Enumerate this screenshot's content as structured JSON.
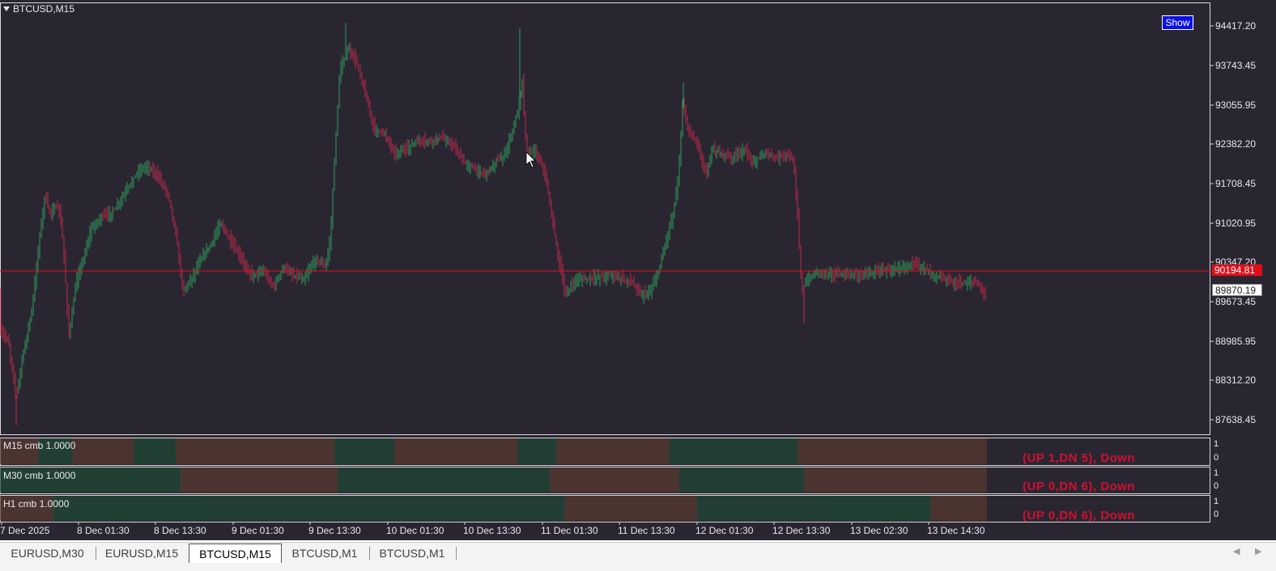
{
  "chart": {
    "symbol_title": "BTCUSD,M15",
    "show_button": "Show",
    "price_ticks": [
      "94417.20",
      "93743.45",
      "93055.95",
      "92382.20",
      "91708.45",
      "91020.95",
      "90347.20",
      "89673.45",
      "88985.95",
      "88312.20",
      "87638.45"
    ],
    "price_line_label": "90194.81",
    "bid_label": "89870.19",
    "time_ticks": [
      "7 Dec 2025",
      "8 Dec 01:30",
      "8 Dec 13:30",
      "9 Dec 01:30",
      "9 Dec 13:30",
      "10 Dec 01:30",
      "10 Dec 13:30",
      "11 Dec 01:30",
      "11 Dec 13:30",
      "12 Dec 01:30",
      "12 Dec 13:30",
      "13 Dec 02:30",
      "13 Dec 14:30"
    ],
    "colors": {
      "background": "#2a2631",
      "bull": "#2e9e5a",
      "bear": "#c0284a",
      "price_line": "#e0101a",
      "strip_up": "#1f4a36",
      "strip_down": "#5a3a30"
    }
  },
  "subwindows": [
    {
      "label": "M15 cmb  1.0000",
      "scale_top": "1",
      "scale_bottom": "0",
      "signal": "(UP 1,DN 5), Down"
    },
    {
      "label": "M30 cmb  1.0000",
      "scale_top": "1",
      "scale_bottom": "0",
      "signal": "(UP 0,DN 6), Down"
    },
    {
      "label": "H1 cmb  1.0000",
      "scale_top": "1",
      "scale_bottom": "0",
      "signal": "(UP 0,DN 6), Down"
    }
  ],
  "tabs": [
    {
      "label": "EURUSD,M30",
      "active": false
    },
    {
      "label": "EURUSD,M15",
      "active": false
    },
    {
      "label": "BTCUSD,M15",
      "active": true
    },
    {
      "label": "BTCUSD,M1",
      "active": false
    },
    {
      "label": "BTCUSD,M1",
      "active": false
    }
  ]
}
